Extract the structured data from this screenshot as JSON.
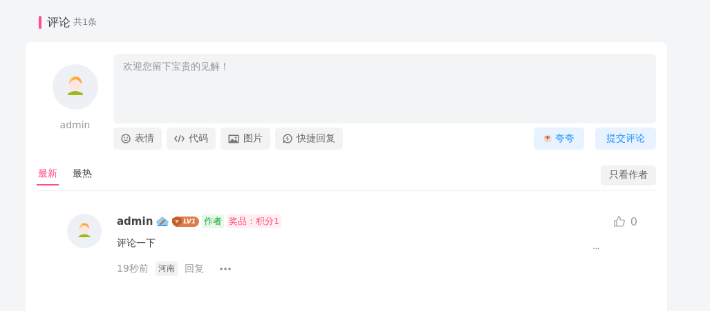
{
  "section": {
    "title": "评论",
    "count": "共1条"
  },
  "composer": {
    "user": "admin",
    "placeholder": "欢迎您留下宝贵的见解！",
    "tools": [
      {
        "kind": "emoji",
        "label": "表情"
      },
      {
        "kind": "code",
        "label": "代码"
      },
      {
        "kind": "image",
        "label": "图片"
      },
      {
        "kind": "quick",
        "label": "快捷回复"
      }
    ],
    "praise_button": "夸夸",
    "submit_button": "提交评论"
  },
  "tabs": [
    {
      "label": "最新",
      "selected": true
    },
    {
      "label": "最热",
      "selected": false
    }
  ],
  "author_only_button": "只看作者",
  "comments": [
    {
      "user": "admin",
      "level": "LV1",
      "tags": [
        {
          "kind": "author",
          "label": "作者"
        },
        {
          "kind": "prize",
          "label": "奖品：积分1"
        }
      ],
      "text": "评论一下",
      "time": "19秒前",
      "location": "河南",
      "reply": "回复",
      "likes": "0",
      "overflow": "..."
    }
  ]
}
